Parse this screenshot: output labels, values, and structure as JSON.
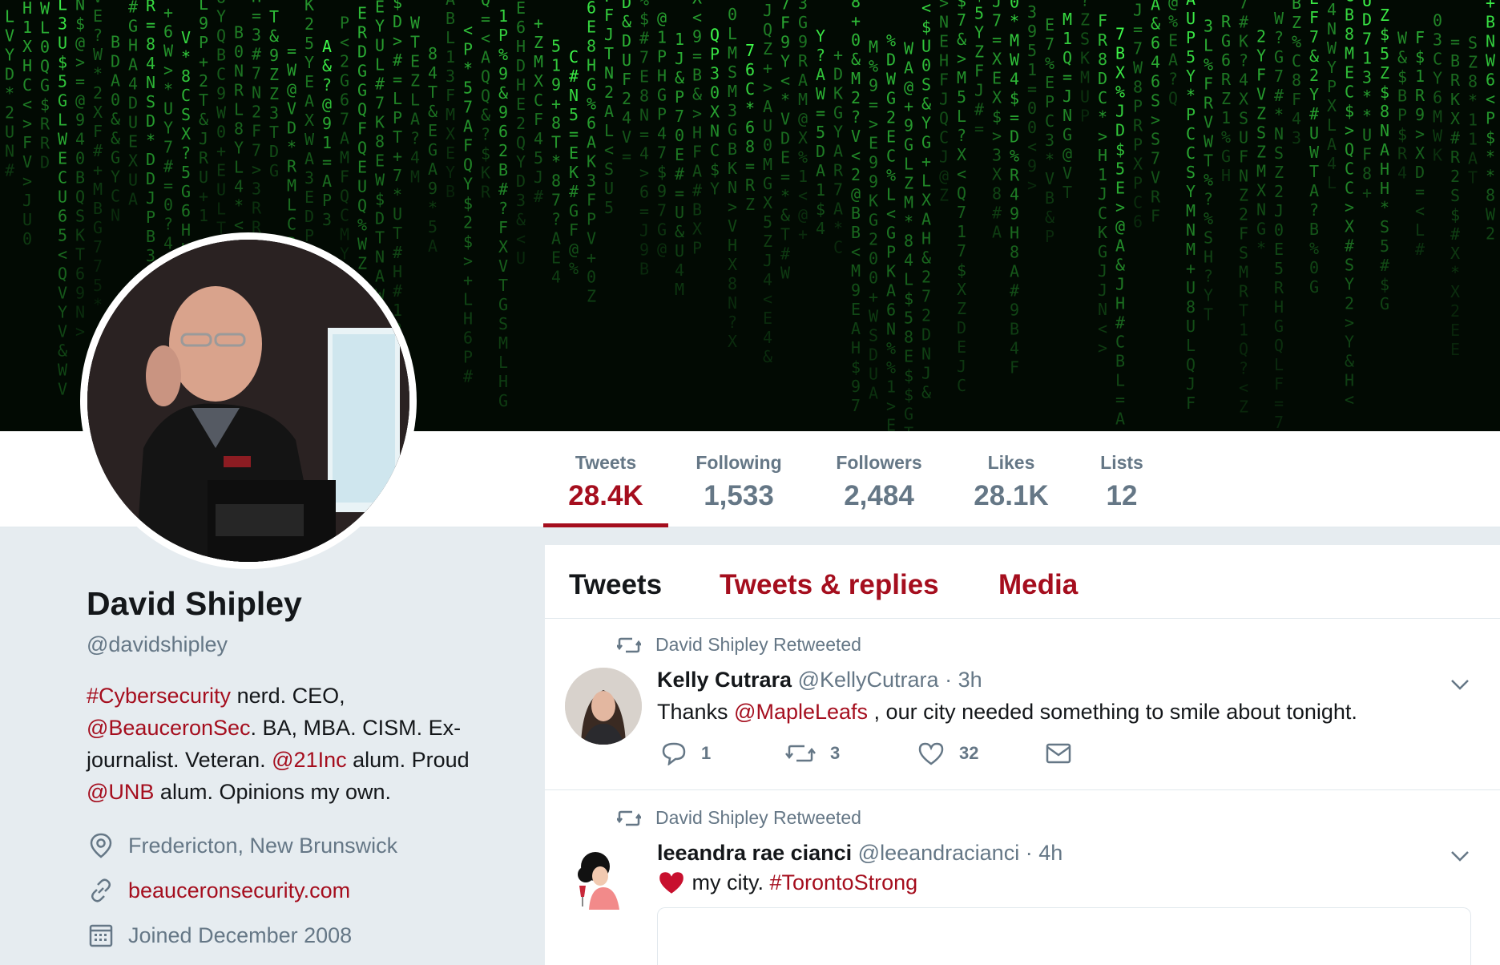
{
  "colors": {
    "accent": "#a50e1e",
    "muted": "#657786",
    "text": "#14171a",
    "background": "#e6ecf0"
  },
  "profile": {
    "name": "David Shipley",
    "handle": "@davidshipley",
    "bio": {
      "part1_link": "#Cybersecurity",
      "part2": " nerd. CEO,",
      "part3_link": "@BeauceronSec",
      "part4": ". BA, MBA. CISM. Ex-journalist. Veteran. ",
      "part5_link": "@21Inc",
      "part6": " alum. Proud ",
      "part7_link": "@UNB",
      "part8": " alum. Opinions my own."
    },
    "location": "Fredericton, New Brunswick",
    "website": "beauceronsecurity.com",
    "joined": "Joined December 2008",
    "icons": {
      "location": "location-pin-icon",
      "website": "link-icon",
      "joined": "calendar-icon"
    }
  },
  "stats": [
    {
      "label": "Tweets",
      "value": "28.4K"
    },
    {
      "label": "Following",
      "value": "1,533"
    },
    {
      "label": "Followers",
      "value": "2,484"
    },
    {
      "label": "Likes",
      "value": "28.1K"
    },
    {
      "label": "Lists",
      "value": "12"
    }
  ],
  "tabs": {
    "tweets": "Tweets",
    "replies": "Tweets & replies",
    "media": "Media"
  },
  "tweets": [
    {
      "retweet_label": "David Shipley Retweeted",
      "name": "Kelly Cutrara",
      "handle": "@KellyCutrara",
      "time": "· 3h",
      "text_pre": "Thanks ",
      "text_link": "@MapleLeafs",
      "text_post": " , our city needed something to smile about tonight.",
      "replies": "1",
      "retweets": "3",
      "likes": "32"
    },
    {
      "retweet_label": "David Shipley Retweeted",
      "name": "leeandra rae cianci",
      "handle": "@leeandracianci",
      "time": "· 4h",
      "text_pre": " my city. ",
      "text_link": "#TorontoStrong"
    }
  ]
}
